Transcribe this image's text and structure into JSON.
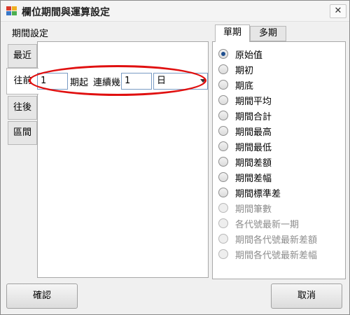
{
  "window": {
    "title": "欄位期間與運算設定",
    "close_label": "✕"
  },
  "period": {
    "group_label": "期間設定",
    "tabs": [
      "最近",
      "往前",
      "往後",
      "區間"
    ],
    "offset_value": "1",
    "start_label": "期起",
    "continuous_label": "連續幾",
    "count_value": "1",
    "unit_value": "日"
  },
  "calc": {
    "tabs": [
      "單期",
      "多期"
    ],
    "options": [
      {
        "label": "原始值",
        "checked": true,
        "enabled": true
      },
      {
        "label": "期初",
        "checked": false,
        "enabled": true
      },
      {
        "label": "期底",
        "checked": false,
        "enabled": true
      },
      {
        "label": "期間平均",
        "checked": false,
        "enabled": true
      },
      {
        "label": "期間合計",
        "checked": false,
        "enabled": true
      },
      {
        "label": "期間最高",
        "checked": false,
        "enabled": true
      },
      {
        "label": "期間最低",
        "checked": false,
        "enabled": true
      },
      {
        "label": "期間差額",
        "checked": false,
        "enabled": true
      },
      {
        "label": "期間差幅",
        "checked": false,
        "enabled": true
      },
      {
        "label": "期間標準差",
        "checked": false,
        "enabled": true
      },
      {
        "label": "期間筆數",
        "checked": false,
        "enabled": false
      },
      {
        "label": "各代號最新一期",
        "checked": false,
        "enabled": false
      },
      {
        "label": "期間各代號最新差額",
        "checked": false,
        "enabled": false
      },
      {
        "label": "期間各代號最新差幅",
        "checked": false,
        "enabled": false
      }
    ]
  },
  "buttons": {
    "ok": "確認",
    "cancel": "取消"
  },
  "colors": {
    "highlight": "#e01010",
    "radio_dot": "#1f4f8f",
    "disabled_text": "#8d8d8d"
  }
}
